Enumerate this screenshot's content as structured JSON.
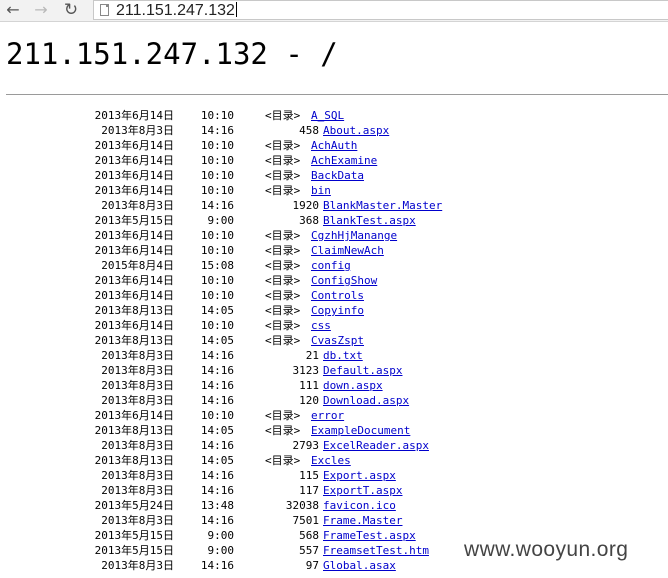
{
  "browser": {
    "back_icon": "arrow-left-icon",
    "forward_icon": "arrow-right-icon",
    "reload_icon": "reload-icon",
    "url": "211.151.247.132"
  },
  "page": {
    "title": "211.151.247.132 - /"
  },
  "listing": [
    {
      "date": "2013年6月14日",
      "time": "10:10",
      "type": "dir",
      "dir_label": "<目录>",
      "name": "A_SQL"
    },
    {
      "date": "2013年8月3日",
      "time": "14:16",
      "type": "file",
      "size": "458",
      "name": "About.aspx"
    },
    {
      "date": "2013年6月14日",
      "time": "10:10",
      "type": "dir",
      "dir_label": "<目录>",
      "name": "AchAuth"
    },
    {
      "date": "2013年6月14日",
      "time": "10:10",
      "type": "dir",
      "dir_label": "<目录>",
      "name": "AchExamine"
    },
    {
      "date": "2013年6月14日",
      "time": "10:10",
      "type": "dir",
      "dir_label": "<目录>",
      "name": "BackData"
    },
    {
      "date": "2013年6月14日",
      "time": "10:10",
      "type": "dir",
      "dir_label": "<目录>",
      "name": "bin"
    },
    {
      "date": "2013年8月3日",
      "time": "14:16",
      "type": "file",
      "size": "1920",
      "name": "BlankMaster.Master"
    },
    {
      "date": "2013年5月15日",
      "time": "9:00",
      "type": "file",
      "size": "368",
      "name": "BlankTest.aspx"
    },
    {
      "date": "2013年6月14日",
      "time": "10:10",
      "type": "dir",
      "dir_label": "<目录>",
      "name": "CgzhHjManange"
    },
    {
      "date": "2013年6月14日",
      "time": "10:10",
      "type": "dir",
      "dir_label": "<目录>",
      "name": "ClaimNewAch"
    },
    {
      "date": "2015年8月4日",
      "time": "15:08",
      "type": "dir",
      "dir_label": "<目录>",
      "name": "config"
    },
    {
      "date": "2013年6月14日",
      "time": "10:10",
      "type": "dir",
      "dir_label": "<目录>",
      "name": "ConfigShow"
    },
    {
      "date": "2013年6月14日",
      "time": "10:10",
      "type": "dir",
      "dir_label": "<目录>",
      "name": "Controls"
    },
    {
      "date": "2013年8月13日",
      "time": "14:05",
      "type": "dir",
      "dir_label": "<目录>",
      "name": "Copyinfo"
    },
    {
      "date": "2013年6月14日",
      "time": "10:10",
      "type": "dir",
      "dir_label": "<目录>",
      "name": "css"
    },
    {
      "date": "2013年8月13日",
      "time": "14:05",
      "type": "dir",
      "dir_label": "<目录>",
      "name": "CvasZspt"
    },
    {
      "date": "2013年8月3日",
      "time": "14:16",
      "type": "file",
      "size": "21",
      "name": "db.txt"
    },
    {
      "date": "2013年8月3日",
      "time": "14:16",
      "type": "file",
      "size": "3123",
      "name": "Default.aspx"
    },
    {
      "date": "2013年8月3日",
      "time": "14:16",
      "type": "file",
      "size": "111",
      "name": "down.aspx"
    },
    {
      "date": "2013年8月3日",
      "time": "14:16",
      "type": "file",
      "size": "120",
      "name": "Download.aspx"
    },
    {
      "date": "2013年6月14日",
      "time": "10:10",
      "type": "dir",
      "dir_label": "<目录>",
      "name": "error"
    },
    {
      "date": "2013年8月13日",
      "time": "14:05",
      "type": "dir",
      "dir_label": "<目录>",
      "name": "ExampleDocument"
    },
    {
      "date": "2013年8月3日",
      "time": "14:16",
      "type": "file",
      "size": "2793",
      "name": "ExcelReader.aspx"
    },
    {
      "date": "2013年8月13日",
      "time": "14:05",
      "type": "dir",
      "dir_label": "<目录>",
      "name": "Excles"
    },
    {
      "date": "2013年8月3日",
      "time": "14:16",
      "type": "file",
      "size": "115",
      "name": "Export.aspx"
    },
    {
      "date": "2013年8月3日",
      "time": "14:16",
      "type": "file",
      "size": "117",
      "name": "ExportT.aspx"
    },
    {
      "date": "2013年5月24日",
      "time": "13:48",
      "type": "file",
      "size": "32038",
      "name": "favicon.ico"
    },
    {
      "date": "2013年8月3日",
      "time": "14:16",
      "type": "file",
      "size": "7501",
      "name": "Frame.Master"
    },
    {
      "date": "2013年5月15日",
      "time": "9:00",
      "type": "file",
      "size": "568",
      "name": "FrameTest.aspx"
    },
    {
      "date": "2013年5月15日",
      "time": "9:00",
      "type": "file",
      "size": "557",
      "name": "FreamsetTest.htm"
    },
    {
      "date": "2013年8月3日",
      "time": "14:16",
      "type": "file",
      "size": "97",
      "name": "Global.asax"
    }
  ],
  "watermark": "www.wooyun.org"
}
